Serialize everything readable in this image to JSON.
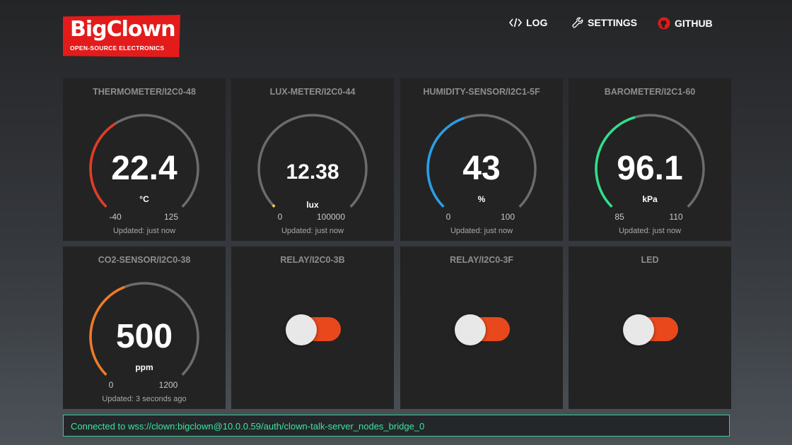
{
  "header": {
    "logo": {
      "name": "BigClown",
      "tagline": "OPEN-SOURCE ELECTRONICS",
      "color": "#e31b1b"
    },
    "nav": [
      {
        "label": "LOG",
        "icon": "code-icon"
      },
      {
        "label": "SETTINGS",
        "icon": "wrench-icon"
      },
      {
        "label": "GITHUB",
        "icon": "github-icon",
        "icon_color": "#e31b1b"
      }
    ]
  },
  "gauges": [
    {
      "title": "THERMOMETER/I2C0-48",
      "value": "22.4",
      "unit": "°C",
      "min": "-40",
      "max": "125",
      "updated": "Updated: just now",
      "fill_fraction": 0.38,
      "color": "#e53b24"
    },
    {
      "title": "LUX-METER/I2C0-44",
      "value": "12.38",
      "unit": "lux",
      "min": "0",
      "max": "100000",
      "updated": "Updated: just now",
      "fill_fraction": 0.01,
      "color": "#f4d03f"
    },
    {
      "title": "HUMIDITY-SENSOR/I2C1-5F",
      "value": "43",
      "unit": "%",
      "min": "0",
      "max": "100",
      "updated": "Updated: just now",
      "fill_fraction": 0.43,
      "color": "#2a9de6"
    },
    {
      "title": "BAROMETER/I2C1-60",
      "value": "96.1",
      "unit": "kPa",
      "min": "85",
      "max": "110",
      "updated": "Updated: just now",
      "fill_fraction": 0.44,
      "color": "#2fe08a"
    },
    {
      "title": "CO2-SENSOR/I2C0-38",
      "value": "500",
      "unit": "ppm",
      "min": "0",
      "max": "1200",
      "updated": "Updated: 3 seconds ago",
      "fill_fraction": 0.42,
      "color": "#f07a26"
    }
  ],
  "switches": [
    {
      "title": "RELAY/I2C0-3B",
      "state": "on",
      "color": "#e8481c"
    },
    {
      "title": "RELAY/I2C0-3F",
      "state": "on",
      "color": "#e8481c"
    },
    {
      "title": "LED",
      "state": "on",
      "color": "#e8481c"
    }
  ],
  "status": {
    "text": "Connected to wss://clown:bigclown@10.0.0.59/auth/clown-talk-server_nodes_bridge_0",
    "color": "#3ee59a"
  }
}
